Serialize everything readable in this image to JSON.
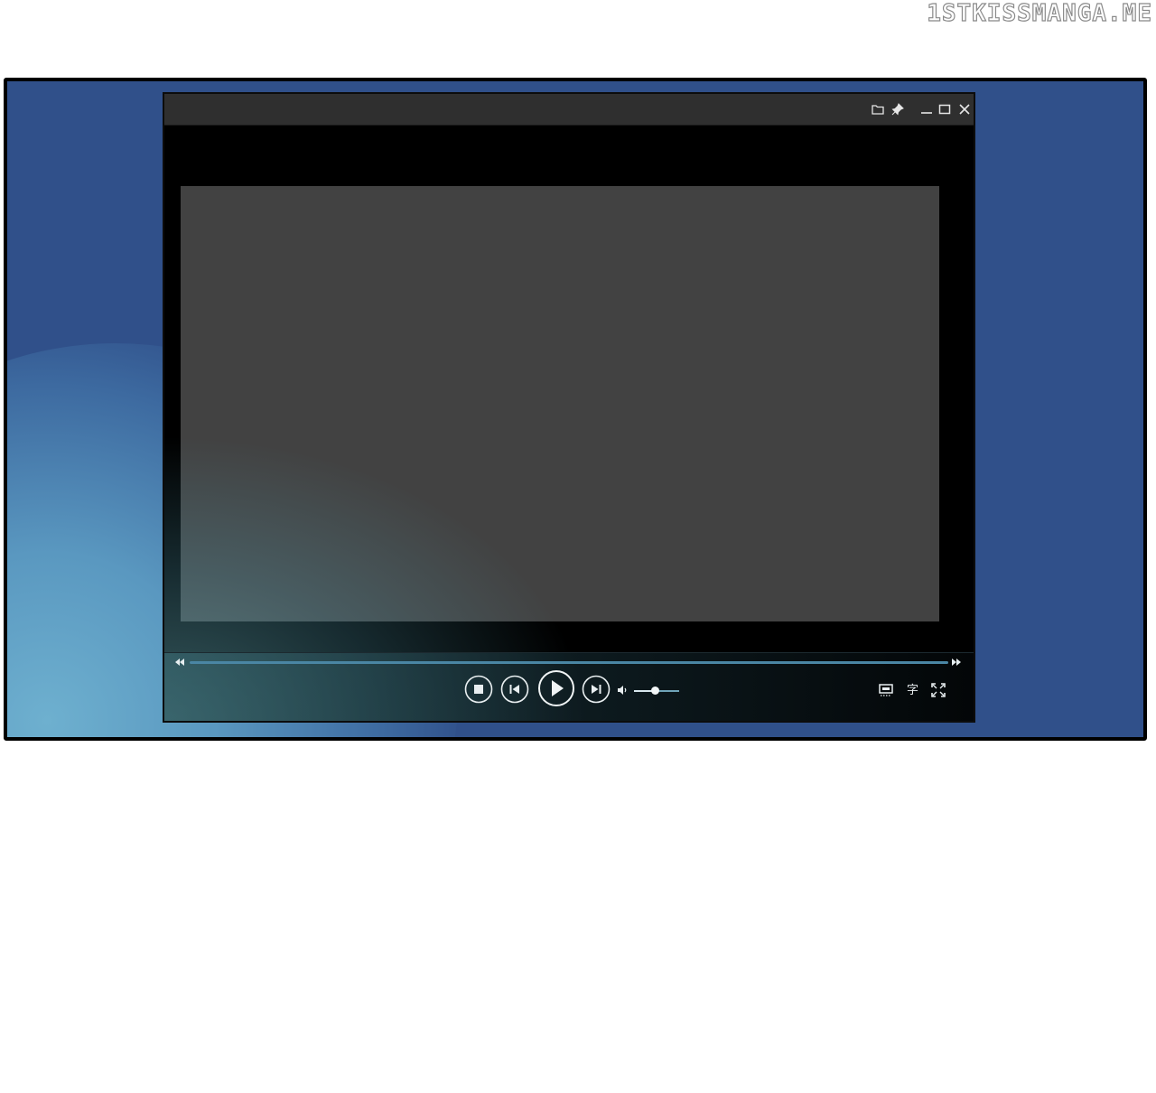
{
  "watermark": "1STKISSMANGA.ME",
  "colors": {
    "desktop": "#30508a",
    "titlebar": "#2f2f2f",
    "viewport": "#424242",
    "accent": "#4a86a4"
  },
  "titlebar": {
    "icons": [
      "folder-icon",
      "pin-icon",
      "minimize-icon",
      "maximize-icon",
      "close-icon"
    ]
  },
  "controls": {
    "seek_progress": 1.0,
    "volume_level": 0.45,
    "icons": [
      "rewind-icon",
      "fast-forward-icon",
      "stop-icon",
      "previous-icon",
      "play-icon",
      "next-icon",
      "volume-icon",
      "screen-icon",
      "subtitle-icon",
      "fullscreen-icon"
    ],
    "subtitle_label": "字"
  }
}
